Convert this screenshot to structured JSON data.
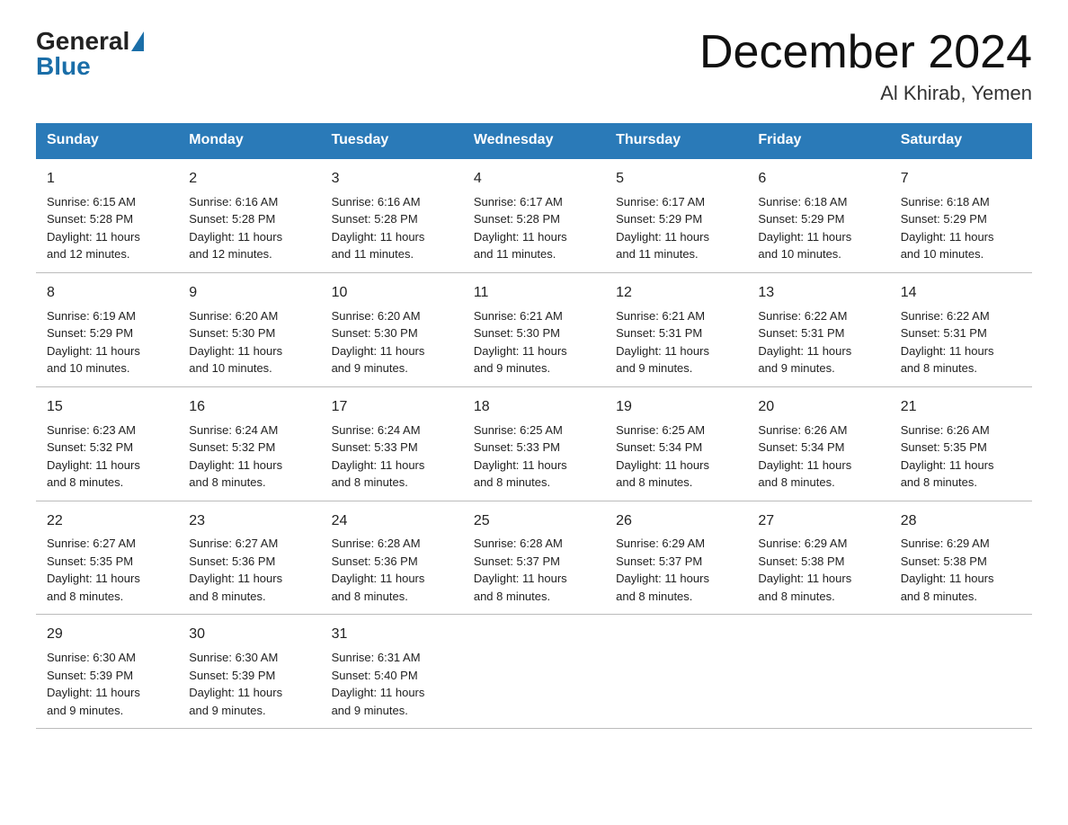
{
  "header": {
    "logo_general": "General",
    "logo_blue": "Blue",
    "month_title": "December 2024",
    "location": "Al Khirab, Yemen"
  },
  "weekdays": [
    "Sunday",
    "Monday",
    "Tuesday",
    "Wednesday",
    "Thursday",
    "Friday",
    "Saturday"
  ],
  "weeks": [
    [
      {
        "day": "1",
        "sunrise": "6:15 AM",
        "sunset": "5:28 PM",
        "daylight": "11 hours and 12 minutes."
      },
      {
        "day": "2",
        "sunrise": "6:16 AM",
        "sunset": "5:28 PM",
        "daylight": "11 hours and 12 minutes."
      },
      {
        "day": "3",
        "sunrise": "6:16 AM",
        "sunset": "5:28 PM",
        "daylight": "11 hours and 11 minutes."
      },
      {
        "day": "4",
        "sunrise": "6:17 AM",
        "sunset": "5:28 PM",
        "daylight": "11 hours and 11 minutes."
      },
      {
        "day": "5",
        "sunrise": "6:17 AM",
        "sunset": "5:29 PM",
        "daylight": "11 hours and 11 minutes."
      },
      {
        "day": "6",
        "sunrise": "6:18 AM",
        "sunset": "5:29 PM",
        "daylight": "11 hours and 10 minutes."
      },
      {
        "day": "7",
        "sunrise": "6:18 AM",
        "sunset": "5:29 PM",
        "daylight": "11 hours and 10 minutes."
      }
    ],
    [
      {
        "day": "8",
        "sunrise": "6:19 AM",
        "sunset": "5:29 PM",
        "daylight": "11 hours and 10 minutes."
      },
      {
        "day": "9",
        "sunrise": "6:20 AM",
        "sunset": "5:30 PM",
        "daylight": "11 hours and 10 minutes."
      },
      {
        "day": "10",
        "sunrise": "6:20 AM",
        "sunset": "5:30 PM",
        "daylight": "11 hours and 9 minutes."
      },
      {
        "day": "11",
        "sunrise": "6:21 AM",
        "sunset": "5:30 PM",
        "daylight": "11 hours and 9 minutes."
      },
      {
        "day": "12",
        "sunrise": "6:21 AM",
        "sunset": "5:31 PM",
        "daylight": "11 hours and 9 minutes."
      },
      {
        "day": "13",
        "sunrise": "6:22 AM",
        "sunset": "5:31 PM",
        "daylight": "11 hours and 9 minutes."
      },
      {
        "day": "14",
        "sunrise": "6:22 AM",
        "sunset": "5:31 PM",
        "daylight": "11 hours and 8 minutes."
      }
    ],
    [
      {
        "day": "15",
        "sunrise": "6:23 AM",
        "sunset": "5:32 PM",
        "daylight": "11 hours and 8 minutes."
      },
      {
        "day": "16",
        "sunrise": "6:24 AM",
        "sunset": "5:32 PM",
        "daylight": "11 hours and 8 minutes."
      },
      {
        "day": "17",
        "sunrise": "6:24 AM",
        "sunset": "5:33 PM",
        "daylight": "11 hours and 8 minutes."
      },
      {
        "day": "18",
        "sunrise": "6:25 AM",
        "sunset": "5:33 PM",
        "daylight": "11 hours and 8 minutes."
      },
      {
        "day": "19",
        "sunrise": "6:25 AM",
        "sunset": "5:34 PM",
        "daylight": "11 hours and 8 minutes."
      },
      {
        "day": "20",
        "sunrise": "6:26 AM",
        "sunset": "5:34 PM",
        "daylight": "11 hours and 8 minutes."
      },
      {
        "day": "21",
        "sunrise": "6:26 AM",
        "sunset": "5:35 PM",
        "daylight": "11 hours and 8 minutes."
      }
    ],
    [
      {
        "day": "22",
        "sunrise": "6:27 AM",
        "sunset": "5:35 PM",
        "daylight": "11 hours and 8 minutes."
      },
      {
        "day": "23",
        "sunrise": "6:27 AM",
        "sunset": "5:36 PM",
        "daylight": "11 hours and 8 minutes."
      },
      {
        "day": "24",
        "sunrise": "6:28 AM",
        "sunset": "5:36 PM",
        "daylight": "11 hours and 8 minutes."
      },
      {
        "day": "25",
        "sunrise": "6:28 AM",
        "sunset": "5:37 PM",
        "daylight": "11 hours and 8 minutes."
      },
      {
        "day": "26",
        "sunrise": "6:29 AM",
        "sunset": "5:37 PM",
        "daylight": "11 hours and 8 minutes."
      },
      {
        "day": "27",
        "sunrise": "6:29 AM",
        "sunset": "5:38 PM",
        "daylight": "11 hours and 8 minutes."
      },
      {
        "day": "28",
        "sunrise": "6:29 AM",
        "sunset": "5:38 PM",
        "daylight": "11 hours and 8 minutes."
      }
    ],
    [
      {
        "day": "29",
        "sunrise": "6:30 AM",
        "sunset": "5:39 PM",
        "daylight": "11 hours and 9 minutes."
      },
      {
        "day": "30",
        "sunrise": "6:30 AM",
        "sunset": "5:39 PM",
        "daylight": "11 hours and 9 minutes."
      },
      {
        "day": "31",
        "sunrise": "6:31 AM",
        "sunset": "5:40 PM",
        "daylight": "11 hours and 9 minutes."
      },
      null,
      null,
      null,
      null
    ]
  ],
  "labels": {
    "sunrise": "Sunrise:",
    "sunset": "Sunset:",
    "daylight": "Daylight:"
  }
}
